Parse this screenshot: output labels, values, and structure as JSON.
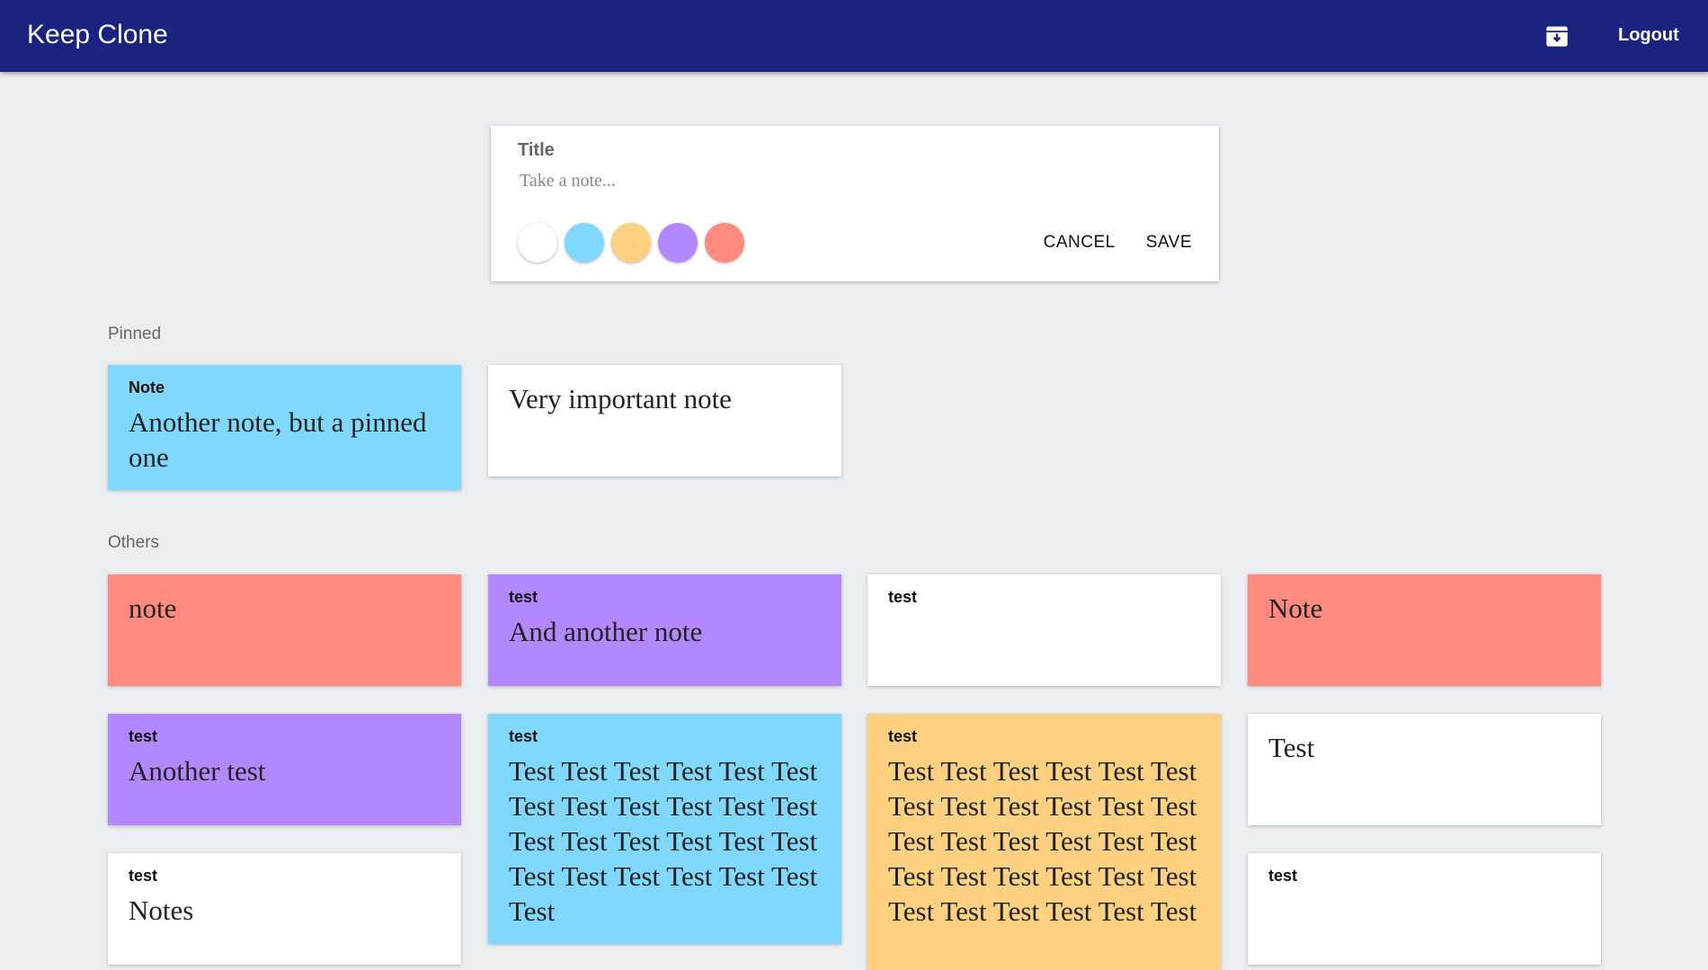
{
  "header": {
    "app_title": "Keep Clone",
    "archive_icon": "archive-icon",
    "logout_label": "Logout"
  },
  "composer": {
    "title_placeholder": "Title",
    "body_placeholder": "Take a note...",
    "colors": [
      {
        "name": "white",
        "hex": "#ffffff"
      },
      {
        "name": "blue",
        "hex": "#80d8ff"
      },
      {
        "name": "orange",
        "hex": "#ffd180"
      },
      {
        "name": "purple",
        "hex": "#b388ff"
      },
      {
        "name": "red",
        "hex": "#ff8a80"
      }
    ],
    "cancel_label": "CANCEL",
    "save_label": "SAVE"
  },
  "sections": {
    "pinned_label": "Pinned",
    "others_label": "Others"
  },
  "pinned_notes": [
    {
      "title": "Note",
      "body": "Another note, but a pinned one",
      "color": "#80d8ff"
    },
    {
      "title": "",
      "body": "Very important note",
      "color": "#ffffff"
    }
  ],
  "other_notes": [
    {
      "title": "",
      "body": "note",
      "color": "#ff8a80"
    },
    {
      "title": "test",
      "body": "And another note",
      "color": "#b388ff"
    },
    {
      "title": "test",
      "body": "",
      "color": "#ffffff"
    },
    {
      "title": "",
      "body": "Note",
      "color": "#ff8a80"
    },
    {
      "title": "test",
      "body": "Another test",
      "color": "#b388ff"
    },
    {
      "title": "test",
      "body": "Test Test Test Test Test Test Test Test Test Test Test Test Test Test Test Test Test Test Test Test Test Test Test Test Test",
      "color": "#80d8ff"
    },
    {
      "title": "test",
      "body": "Test Test Test Test Test Test Test Test Test Test Test Test Test Test Test Test Test Test Test Test Test Test Test Test Test Test Test Test Test Test",
      "color": "#ffd180"
    },
    {
      "title": "",
      "body": "Test",
      "color": "#ffffff"
    },
    {
      "title": "test",
      "body": "Notes",
      "color": "#ffffff"
    },
    {
      "title": "test",
      "body": "",
      "color": "#ffffff"
    }
  ]
}
